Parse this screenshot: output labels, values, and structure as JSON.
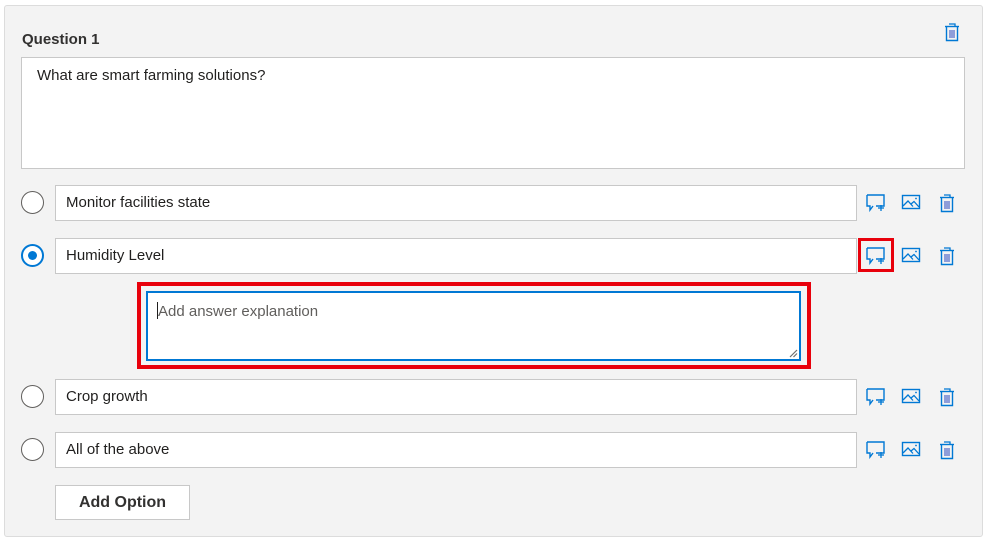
{
  "question": {
    "label": "Question 1",
    "text": "What are smart farming solutions?"
  },
  "options": [
    {
      "text": "Monitor facilities state",
      "selected": false
    },
    {
      "text": "Humidity Level",
      "selected": true
    },
    {
      "text": "Crop growth",
      "selected": false
    },
    {
      "text": "All of the above",
      "selected": false
    }
  ],
  "explanation": {
    "placeholder": "Add answer explanation",
    "value": ""
  },
  "buttons": {
    "add_option": "Add Option"
  },
  "icons": {
    "question_delete": "trash-icon",
    "option_comment": "comment-add-icon",
    "option_image": "image-icon",
    "option_delete": "trash-icon"
  },
  "colors": {
    "accent": "#0078d4",
    "highlight": "#e8000b",
    "card_bg": "#f3f3f3"
  }
}
